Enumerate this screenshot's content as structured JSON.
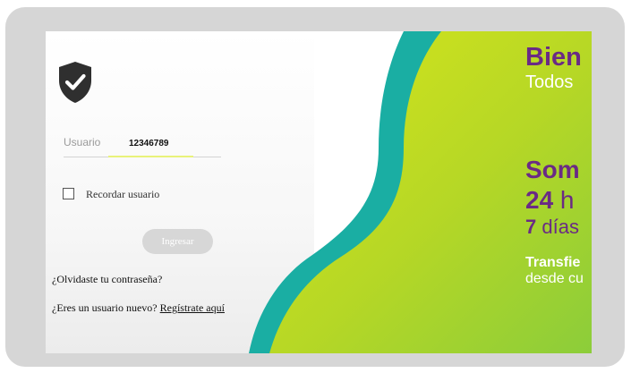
{
  "login": {
    "username_label": "Usuario",
    "username_value": "12346789",
    "remember_label": "Recordar usuario",
    "login_button": "Ingresar",
    "forgot_password": "¿Olvidaste tu contraseña?",
    "new_user_prompt": "¿Eres un usuario nuevo?",
    "register_link": "Regístrate aquí"
  },
  "promo": {
    "line1": "Bien",
    "line2": "Todos",
    "line3": "Som",
    "line4_num": "24",
    "line4_text": " h",
    "line5_num": "7",
    "line5_text": " días",
    "line6": "Transfie",
    "line7": "desde cu"
  },
  "colors": {
    "teal": "#1aaea3",
    "lime": "#a8d42a",
    "purple": "#6a2a85",
    "shield": "#2f2f2f"
  },
  "icons": {
    "shield": "shield-check-icon"
  }
}
